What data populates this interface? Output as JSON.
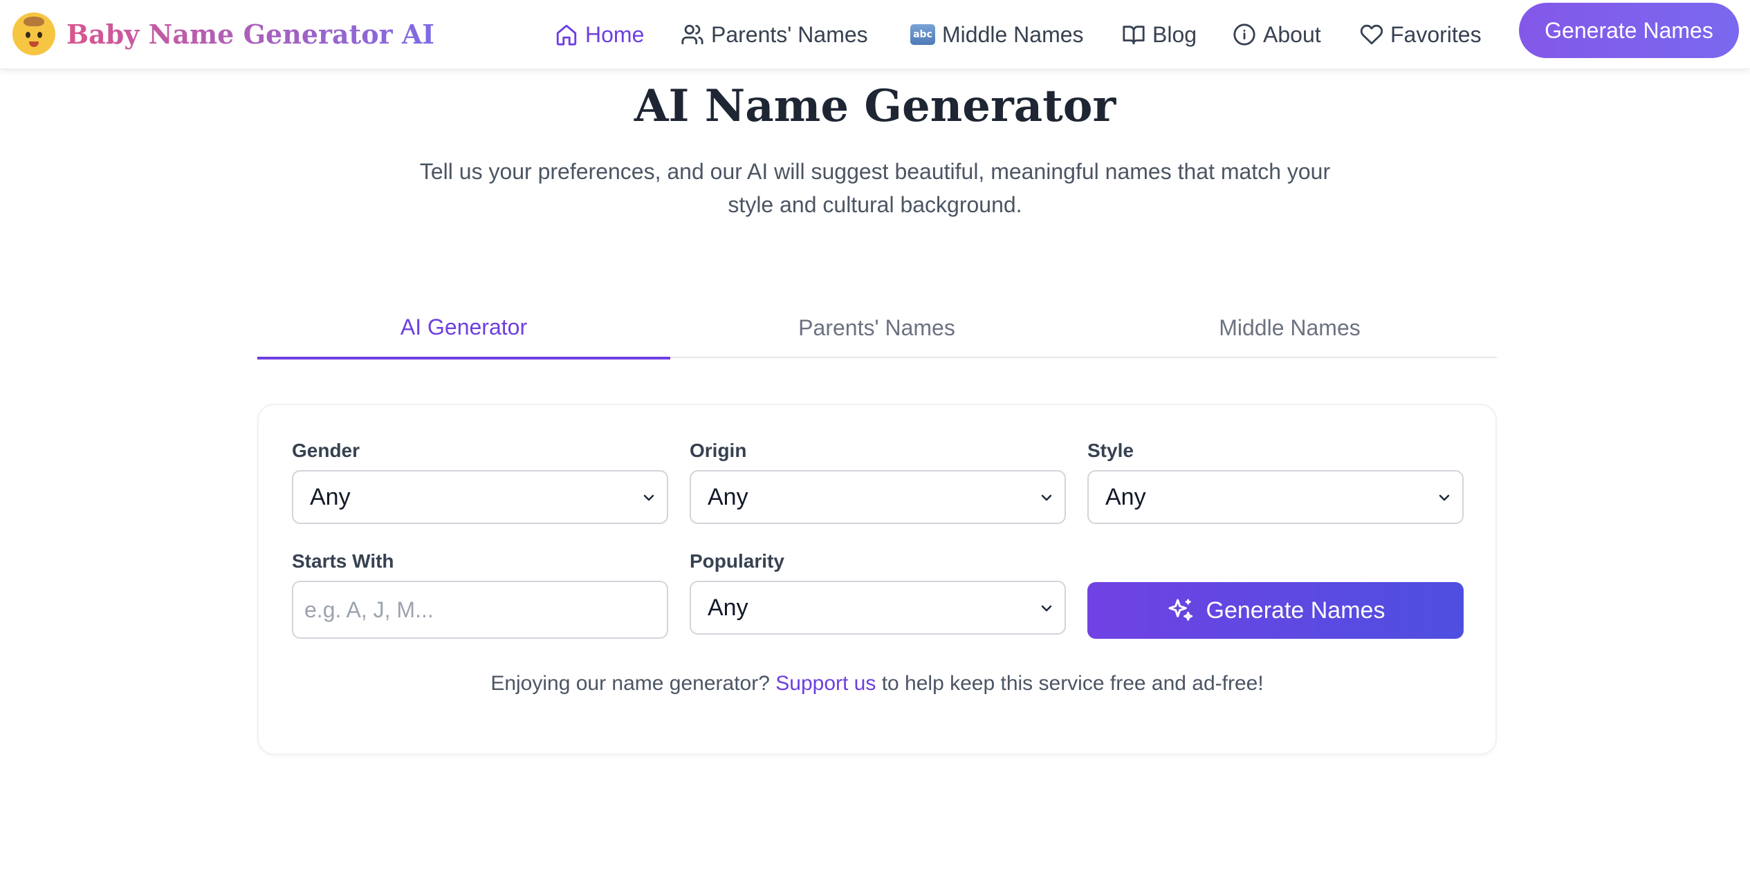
{
  "header": {
    "logo_text": "Baby Name Generator AI",
    "nav": [
      {
        "label": "Home",
        "icon": "home-icon",
        "active": true
      },
      {
        "label": "Parents' Names",
        "icon": "users-icon"
      },
      {
        "label": "Middle Names",
        "icon": "abc-icon"
      },
      {
        "label": "Blog",
        "icon": "book-icon"
      },
      {
        "label": "About",
        "icon": "info-icon"
      },
      {
        "label": "Favorites",
        "icon": "heart-icon"
      }
    ],
    "abc_glyph": "abc",
    "cta_label": "Generate Names"
  },
  "hero": {
    "title": "AI Name Generator",
    "subtitle": "Tell us your preferences, and our AI will suggest beautiful, meaningful names that match your style and cultural background."
  },
  "tabs": [
    {
      "label": "AI Generator",
      "active": true
    },
    {
      "label": "Parents' Names"
    },
    {
      "label": "Middle Names"
    }
  ],
  "form": {
    "gender": {
      "label": "Gender",
      "value": "Any"
    },
    "origin": {
      "label": "Origin",
      "value": "Any"
    },
    "style": {
      "label": "Style",
      "value": "Any"
    },
    "starts_with": {
      "label": "Starts With",
      "placeholder": "e.g. A, J, M...",
      "value": ""
    },
    "popularity": {
      "label": "Popularity",
      "value": "Any"
    },
    "generate_label": "Generate Names"
  },
  "support": {
    "prefix": "Enjoying our name generator?",
    "link": "Support us",
    "suffix": "to help keep this service free and ad-free!"
  },
  "colors": {
    "accent": "#6d3fe0",
    "button_gradient_start": "#7042e3",
    "button_gradient_end": "#4e4fe0",
    "text": "#1e2533"
  }
}
